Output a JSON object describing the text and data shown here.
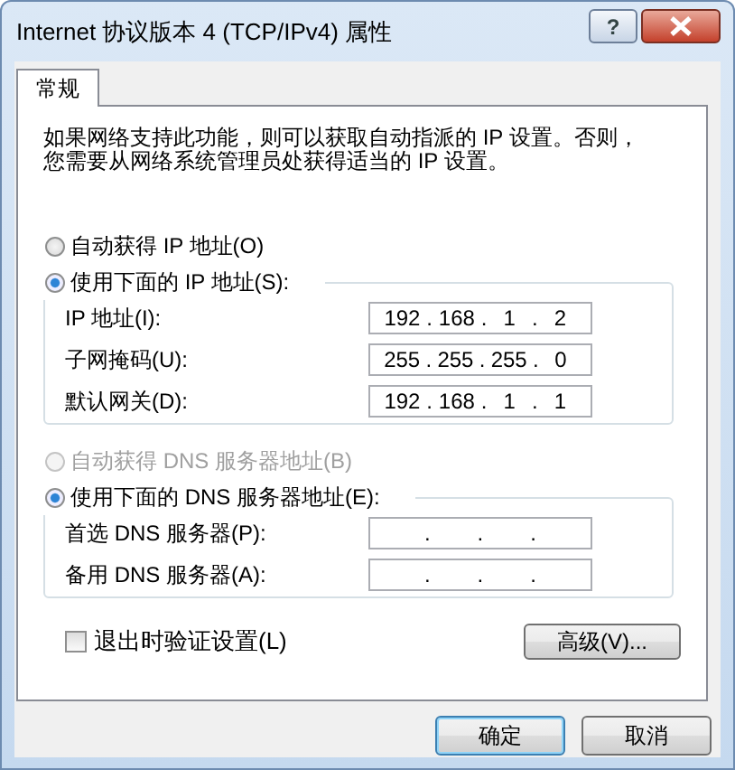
{
  "window": {
    "title": "Internet 协议版本 4 (TCP/IPv4) 属性",
    "help_button": "?"
  },
  "tabs": [
    {
      "label": "常规",
      "selected": true
    }
  ],
  "description": [
    "如果网络支持此功能，则可以获取自动指派的 IP 设置。否则，",
    "您需要从网络系统管理员处获得适当的 IP 设置。"
  ],
  "ip_separator": ".",
  "sections": [
    {
      "auto_option": {
        "label": "自动获得 IP 地址(O)",
        "selected": false,
        "disabled": false
      },
      "manual_option": {
        "label": "使用下面的 IP 地址(S):",
        "selected": true,
        "disabled": false
      },
      "fields": [
        {
          "label": "IP 地址(I):",
          "octets": [
            "192",
            "168",
            "1",
            "2"
          ]
        },
        {
          "label": "子网掩码(U):",
          "octets": [
            "255",
            "255",
            "255",
            "0"
          ]
        },
        {
          "label": "默认网关(D):",
          "octets": [
            "192",
            "168",
            "1",
            "1"
          ]
        }
      ]
    },
    {
      "auto_option": {
        "label": "自动获得 DNS 服务器地址(B)",
        "selected": false,
        "disabled": true
      },
      "manual_option": {
        "label": "使用下面的 DNS 服务器地址(E):",
        "selected": true,
        "disabled": false
      },
      "fields": [
        {
          "label": "首选 DNS 服务器(P):"
        },
        {
          "label": "备用 DNS 服务器(A):"
        }
      ]
    }
  ],
  "validate_checkbox": {
    "label": "退出时验证设置(L)",
    "checked": false
  },
  "advanced_button": "高级(V)...",
  "buttons": [
    {
      "label": "确定",
      "kind": "default"
    },
    {
      "label": "取消",
      "kind": "normal"
    }
  ]
}
